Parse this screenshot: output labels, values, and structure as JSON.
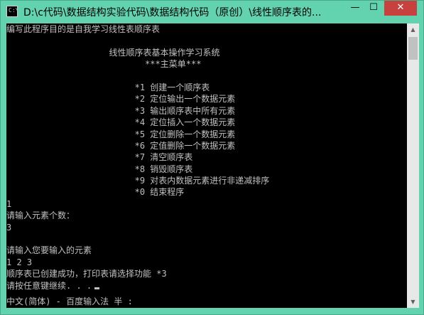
{
  "window": {
    "title": "D:\\c代码\\数据结构实验代码\\数据结构代码（原创）\\线性顺序表的...",
    "minimize_glyph": "—",
    "maximize_glyph": "☐",
    "close_glyph": "✕",
    "icon_text": "C:\\"
  },
  "console": {
    "lines": [
      "编写此程序目的是自我学习线性表顺序表",
      "",
      "                    线性顺序表基本操作学习系统",
      "                           ***主菜单***",
      "",
      "                         *1 创建一个顺序表",
      "                         *2 定位输出一个数据元素",
      "                         *3 输出顺序表中所有元素",
      "                         *4 定位插入一个数据元素",
      "                         *5 定位删除一个数据元素",
      "                         *6 定值删除一个数据元素",
      "                         *7 清空顺序表",
      "                         *8 销毁顺序表",
      "                         *9 对表内数据元素进行非递减排序",
      "                         *0 结束程序",
      "1",
      "请输入元素个数：",
      "3",
      "",
      "请输入您要输入的元素",
      "1 2 3",
      "顺序表已创建成功，打印表请选择功能 *3",
      "请按任意键继续. . ."
    ]
  },
  "ime": {
    "status": "中文(简体) - 百度输入法 半 :"
  }
}
